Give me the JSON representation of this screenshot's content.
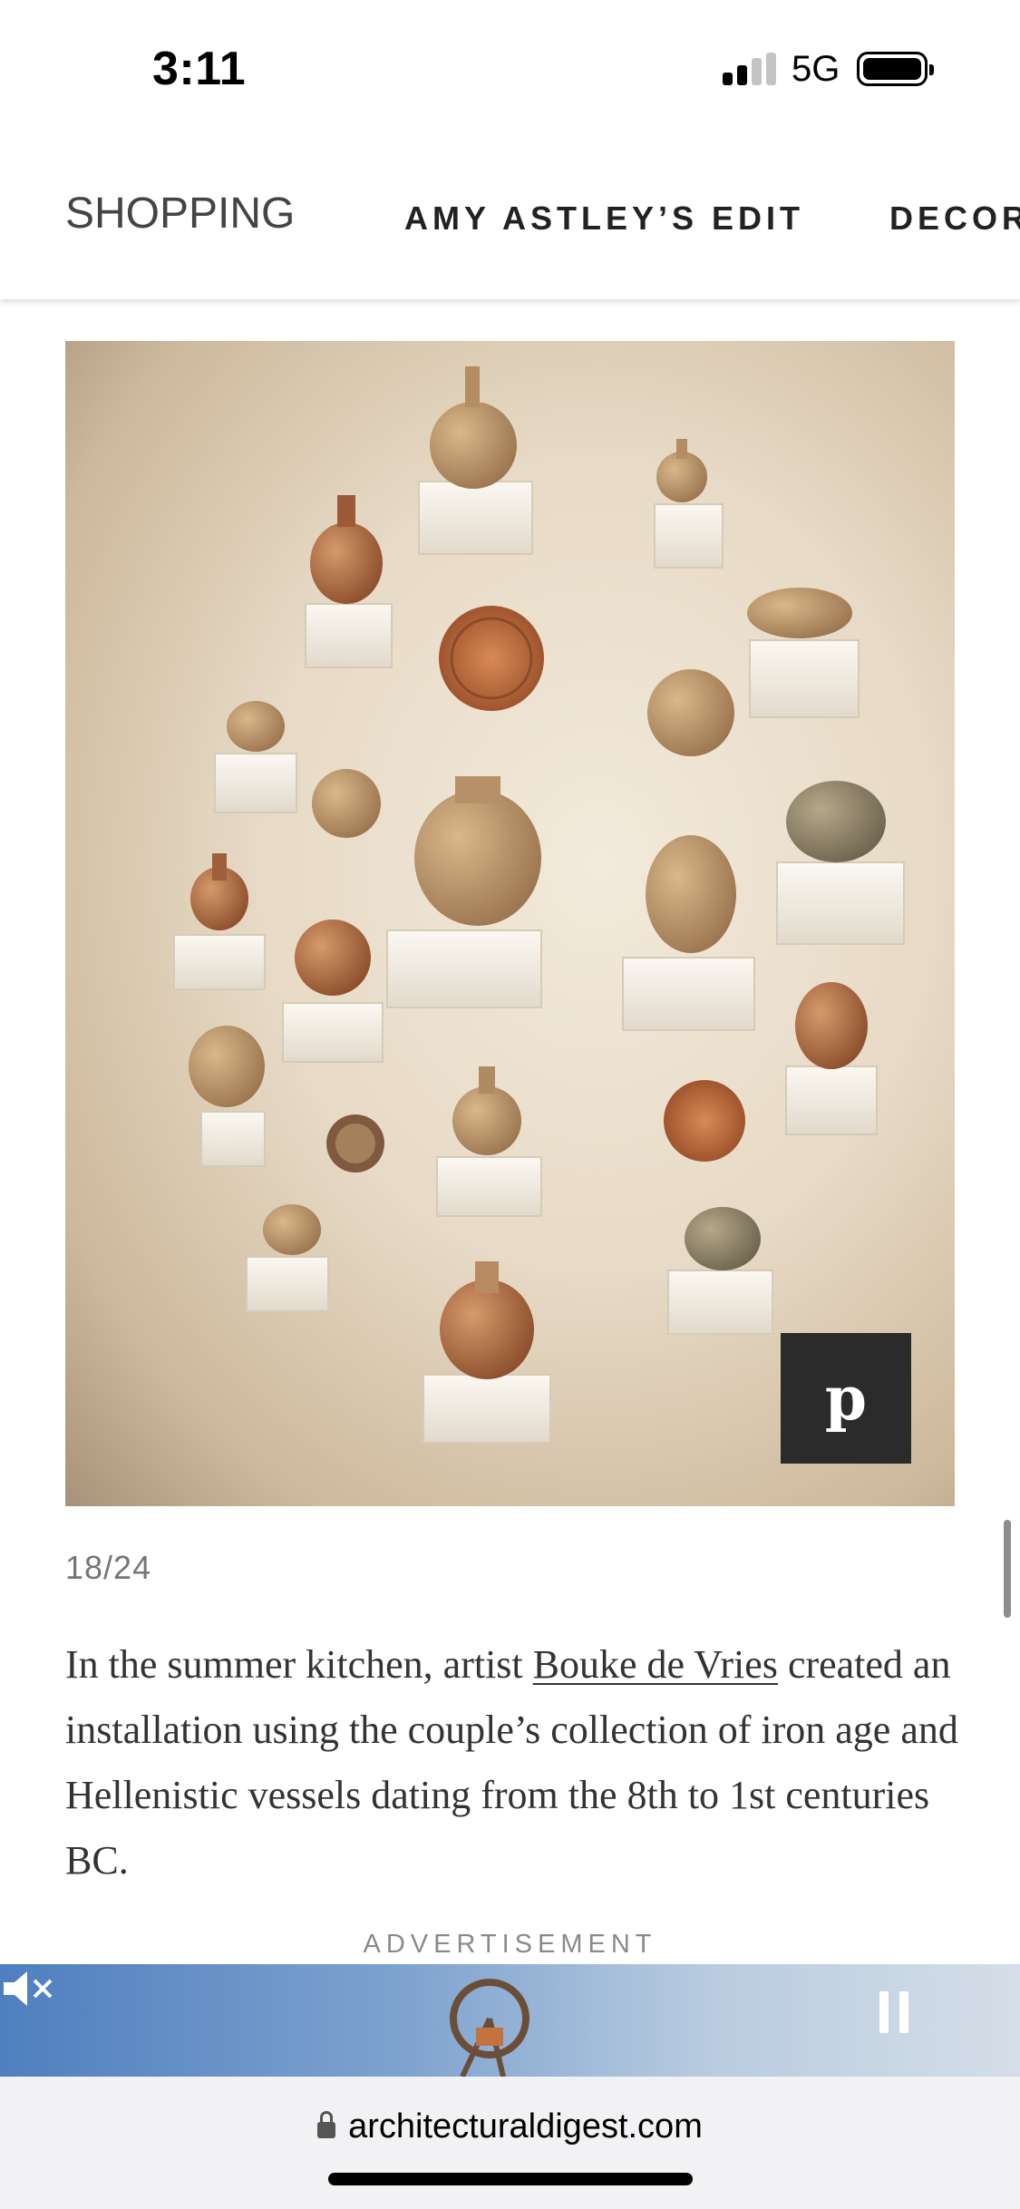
{
  "status_bar": {
    "time": "3:11",
    "network": "5G",
    "signal_bars_active": 2,
    "signal_bars_total": 4,
    "battery_level": 0.9
  },
  "nav": {
    "items": [
      {
        "label": "SHOPPING"
      },
      {
        "label": "AMY ASTLEY’S EDIT"
      },
      {
        "label": "DECOR"
      }
    ]
  },
  "gallery": {
    "image_icon": "pottery-wall-photo",
    "pin_icon": "pinterest-icon",
    "pin_glyph": "p",
    "counter": "18/24"
  },
  "caption": {
    "before_link": "In the summer kitchen, artist ",
    "link_text": "Bouke de Vries",
    "after_link": " created an installation using the couple’s collection of iron age and Hellenistic vessels dating from the 8th to 1st centuries BC."
  },
  "ad": {
    "label": "ADVERTISEMENT",
    "pause_icon": "pause-icon",
    "mute_icon": "mute-icon"
  },
  "address_bar": {
    "lock_icon": "lock-icon",
    "url": "architecturaldigest.com"
  },
  "colors": {
    "pin_button_bg": "#2b2b2b",
    "caption_text": "#333333",
    "counter_text": "#767676"
  }
}
